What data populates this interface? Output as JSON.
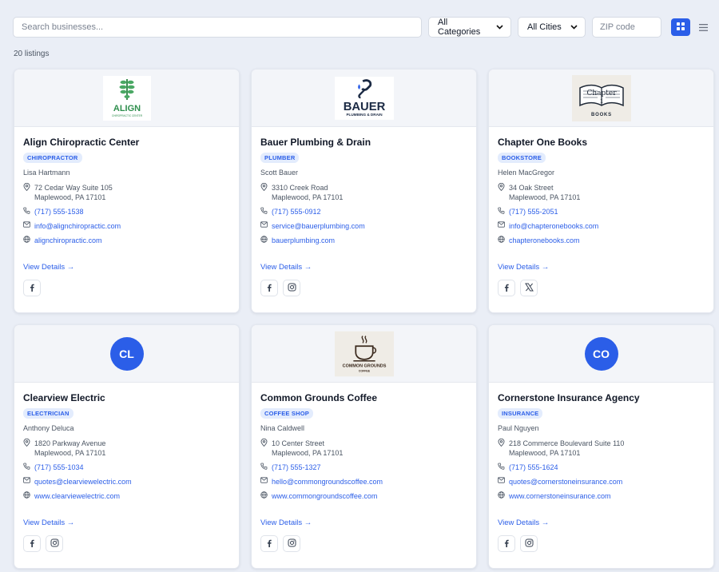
{
  "toolbar": {
    "search_placeholder": "Search businesses...",
    "category_select": "All Categories",
    "city_select": "All Cities",
    "zip_placeholder": "ZIP code"
  },
  "listing_count": "20 listings",
  "listings": [
    {
      "name": "Align Chiropractic Center",
      "category": "CHIROPRACTOR",
      "owner": "Lisa Hartmann",
      "address_line1": "72 Cedar Way Suite 105",
      "address_line2": "Maplewood, PA 17101",
      "phone": "(717) 555-1538",
      "email": "info@alignchiropractic.com",
      "website": "alignchiropractic.com",
      "logo_text": "ALIGN",
      "logo_subtext": "CHIROPRACTIC CENTER",
      "view_details": "View Details →",
      "socials": [
        "facebook-icon"
      ]
    },
    {
      "name": "Bauer Plumbing & Drain",
      "category": "PLUMBER",
      "owner": "Scott Bauer",
      "address_line1": "3310 Creek Road",
      "address_line2": "Maplewood, PA 17101",
      "phone": "(717) 555-0912",
      "email": "service@bauerplumbing.com",
      "website": "bauerplumbing.com",
      "logo_text": "BAUER",
      "logo_subtext": "PLUMBING & DRAIN",
      "view_details": "View Details →",
      "socials": [
        "facebook-icon",
        "instagram-icon"
      ]
    },
    {
      "name": "Chapter One Books",
      "category": "BOOKSTORE",
      "owner": "Helen MacGregor",
      "address_line1": "34 Oak Street",
      "address_line2": "Maplewood, PA 17101",
      "phone": "(717) 555-2051",
      "email": "info@chapteronebooks.com",
      "website": "chapteronebooks.com",
      "logo_text": "Chapter",
      "logo_subtext": "BOOKS",
      "view_details": "View Details →",
      "socials": [
        "facebook-icon",
        "x-icon"
      ]
    },
    {
      "name": "Clearview Electric",
      "category": "ELECTRICIAN",
      "owner": "Anthony Deluca",
      "address_line1": "1820 Parkway Avenue",
      "address_line2": "Maplewood, PA 17101",
      "phone": "(717) 555-1034",
      "email": "quotes@clearviewelectric.com",
      "website": "www.clearviewelectric.com",
      "initials": "CL",
      "view_details": "View Details →",
      "socials": [
        "facebook-icon",
        "instagram-icon"
      ]
    },
    {
      "name": "Common Grounds Coffee",
      "category": "COFFEE SHOP",
      "owner": "Nina Caldwell",
      "address_line1": "10 Center Street",
      "address_line2": "Maplewood, PA 17101",
      "phone": "(717) 555-1327",
      "email": "hello@commongroundscoffee.com",
      "website": "www.commongroundscoffee.com",
      "logo_text": "COMMON GROUNDS",
      "logo_subtext": "COFFEE",
      "view_details": "View Details →",
      "socials": [
        "facebook-icon",
        "instagram-icon"
      ]
    },
    {
      "name": "Cornerstone Insurance Agency",
      "category": "INSURANCE",
      "owner": "Paul Nguyen",
      "address_line1": "218 Commerce Boulevard Suite 110",
      "address_line2": "Maplewood, PA 17101",
      "phone": "(717) 555-1624",
      "email": "quotes@cornerstoneinsurance.com",
      "website": "www.cornerstoneinsurance.com",
      "initials": "CO",
      "view_details": "View Details →",
      "socials": [
        "facebook-icon",
        "instagram-icon"
      ]
    }
  ],
  "colors": {
    "accent": "#2b5ee8",
    "badge_bg": "#e3ecfd",
    "page_bg": "#eaeef6"
  }
}
